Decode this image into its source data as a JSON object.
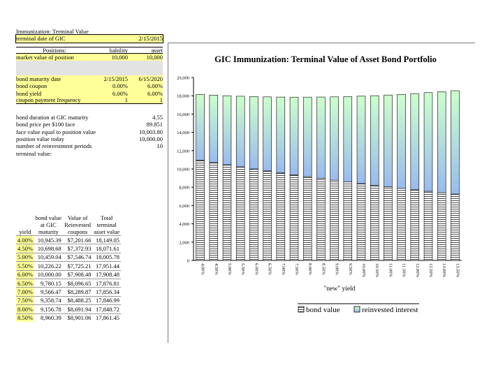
{
  "sheet": {
    "title": "Immunization: Terminal Value",
    "terminal_date_label": "terminal date of GIC",
    "terminal_date_value": "2/15/2015",
    "positions_header": "Positions:",
    "liability_header": "liability",
    "asset_header": "asset",
    "market_value_label": "market value of position",
    "market_value_liability": "10,000",
    "market_value_asset": "10,000",
    "bond_maturity_label": "bond maturity date",
    "bond_maturity_liability": "2/15/2015",
    "bond_maturity_asset": "6/15/2020",
    "bond_coupon_label": "bond coupon",
    "bond_coupon_liability": "0.00%",
    "bond_coupon_asset": "6.00%",
    "bond_yield_label": "bond yield",
    "bond_yield_liability": "6.00%",
    "bond_yield_asset": "6.00%",
    "coupon_freq_label": "coupon payment frequency",
    "coupon_freq_liability": "1",
    "coupon_freq_asset": "1",
    "duration_label": "bond duration at GIC maturity",
    "duration_value": "4.55",
    "price_label": "bond price per $100 face",
    "price_value": "89.851",
    "face_label": "face value equal to position value",
    "face_value": "10,003.80",
    "position_today_label": "position value today",
    "position_today_value": "10,000.00",
    "periods_label": "number of reinvestment periods",
    "periods_value": "10",
    "terminal_value_label": "terminal value:"
  },
  "table": {
    "headers": [
      "yield",
      "bond value at GIC maturity",
      "Value of Reinvested coupons",
      "Total terminal asset value"
    ],
    "rows": [
      [
        "4.00%",
        "10,945.39",
        "$7,201.66",
        "18,149.05"
      ],
      [
        "4.50%",
        "10,698.68",
        "$7,372.93",
        "18,071.61"
      ],
      [
        "5.00%",
        "10,459.04",
        "$7,546.74",
        "18,005.78"
      ],
      [
        "5.50%",
        "10,226.22",
        "$7,725.21",
        "17,951.44"
      ],
      [
        "6.00%",
        "10,000.00",
        "$7,908.48",
        "17,908.48"
      ],
      [
        "6.50%",
        "9,780.15",
        "$8,096.65",
        "17,876.81"
      ],
      [
        "7.00%",
        "9,566.47",
        "$8,289.87",
        "17,856.34"
      ],
      [
        "7.50%",
        "9,358.74",
        "$8,488.25",
        "17,846.99"
      ],
      [
        "8.00%",
        "9,156.78",
        "$8,691.94",
        "17,848.72"
      ],
      [
        "8.50%",
        "8,960.39",
        "$8,901.06",
        "17,861.45"
      ]
    ]
  },
  "colors": {
    "bond_fill": "#ffffff",
    "bond_stripe": "#333333",
    "reinvest_top": "#ccffcc",
    "reinvest_bottom": "#99bbee",
    "highlight": "#ffff99"
  },
  "chart_data": {
    "type": "bar",
    "stacked": true,
    "title": "GIC Immunization: Terminal Value of Asset Bond Portfolio",
    "xlabel": "\"new\" yield",
    "ylabel": "",
    "ylim": [
      0,
      20000
    ],
    "yticks": [
      0,
      2000,
      4000,
      6000,
      8000,
      10000,
      12000,
      14000,
      16000,
      18000,
      20000
    ],
    "ytick_labels": [
      "0",
      "2,000",
      "4,000",
      "6,000",
      "8,000",
      "10,000",
      "12,000",
      "14,000",
      "16,000",
      "18,000",
      "20,000"
    ],
    "categories": [
      "4.00%",
      "4.50%",
      "5.00%",
      "5.50%",
      "6.00%",
      "6.50%",
      "7.00%",
      "7.50%",
      "8.00%",
      "8.50%",
      "9.00%",
      "9.50%",
      "10.00%",
      "10.50%",
      "11.00%",
      "11.50%",
      "12.00%",
      "12.50%",
      "13.00%",
      "13.50%"
    ],
    "series": [
      {
        "name": "bond value",
        "values": [
          10945,
          10699,
          10459,
          10226,
          10000,
          9780,
          9566,
          9359,
          9157,
          8960,
          8770,
          8580,
          8400,
          8220,
          8050,
          7880,
          7720,
          7560,
          7400,
          7250
        ]
      },
      {
        "name": "reinvested interest",
        "values": [
          7202,
          7373,
          7547,
          7725,
          7908,
          8097,
          8290,
          8488,
          8692,
          8901,
          9110,
          9330,
          9560,
          9790,
          10030,
          10270,
          10520,
          10780,
          11040,
          11300
        ]
      }
    ],
    "legend_position": "bottom"
  }
}
